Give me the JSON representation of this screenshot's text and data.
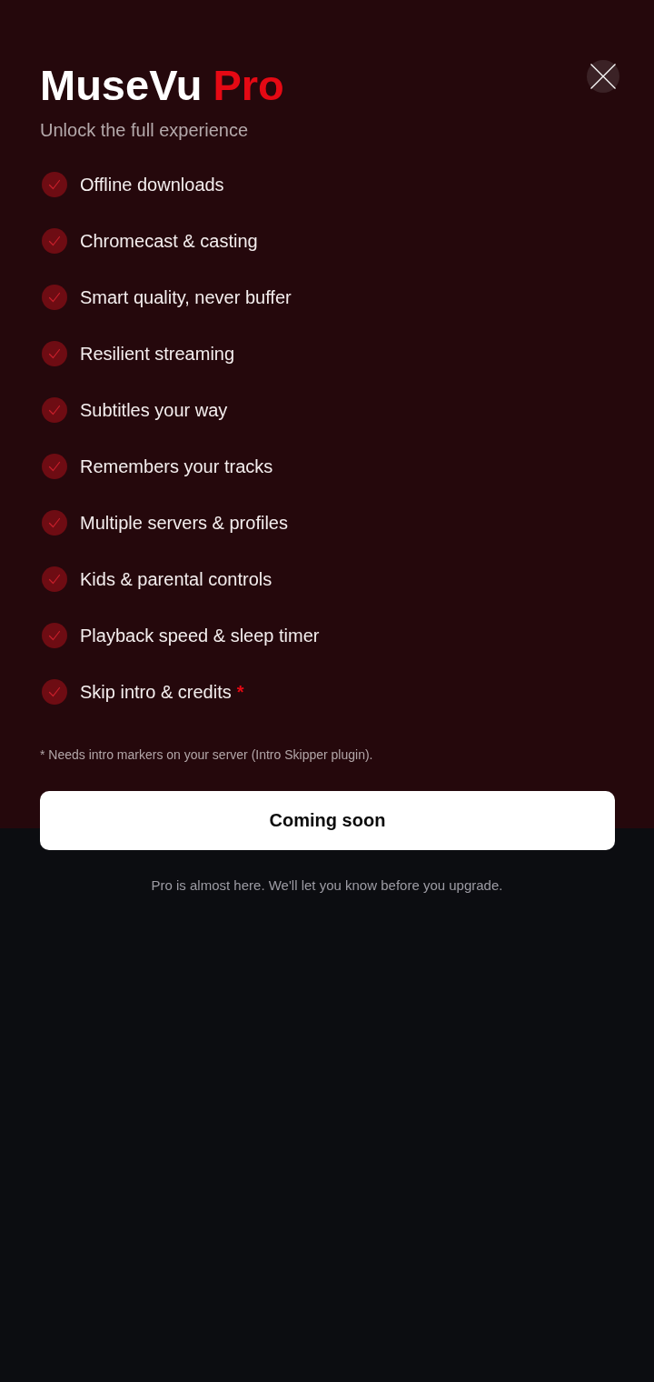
{
  "header": {
    "title": "MuseVu",
    "title_accent": "Pro",
    "subtitle": "Unlock the full experience"
  },
  "features": [
    {
      "label": "Offline downloads"
    },
    {
      "label": "Chromecast & casting"
    },
    {
      "label": "Smart quality, never buffer"
    },
    {
      "label": "Resilient streaming"
    },
    {
      "label": "Subtitles your way"
    },
    {
      "label": "Remembers your tracks"
    },
    {
      "label": "Multiple servers & profiles"
    },
    {
      "label": "Kids & parental controls"
    },
    {
      "label": "Playback speed & sleep timer"
    },
    {
      "label": "Skip intro & credits",
      "footnote_mark": "*"
    }
  ],
  "footnote": "* Needs intro markers on your server (Intro Skipper plugin).",
  "cta": {
    "label": "Coming soon"
  },
  "note": "Pro is almost here. We'll let you know before you upgrade."
}
